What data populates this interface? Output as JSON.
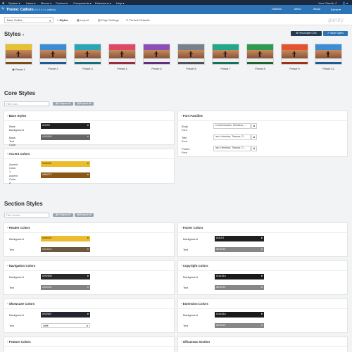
{
  "system_bar": {
    "logo": "✖",
    "menus": [
      "System ▾",
      "Users ▾",
      "Menus ▾",
      "Content ▾",
      "Components ▾",
      "Extensions ▾",
      "Help ▾"
    ],
    "right": [
      "Your Church ↗",
      "👤 ▾"
    ]
  },
  "header": {
    "title": "Theme: Callisto",
    "version": "(v1.0.4 / c_callisto)",
    "links": [
      "Outlines",
      "Menu",
      "About",
      "Extras ▾"
    ]
  },
  "toolbar": {
    "outline_value": "Base Outline",
    "tabs": [
      "Styles",
      "Layout",
      "Page Settings",
      "Particle Defaults"
    ],
    "brand": "gantry"
  },
  "styles": {
    "title": "Styles",
    "recompile_label": "Recompile CSS",
    "save_label": "Save Styles",
    "presets": [
      {
        "label": "Preset 1",
        "band": "#e8c12f",
        "accent": "#7a4b12",
        "selected": true
      },
      {
        "label": "Preset 2",
        "band": "#3b8ed6",
        "accent": "#1e5b94",
        "selected": false
      },
      {
        "label": "Preset 3",
        "band": "#2aa6b7",
        "accent": "#1b6a78",
        "selected": false
      },
      {
        "label": "Preset 4",
        "band": "#e14868",
        "accent": "#952d45",
        "selected": false
      },
      {
        "label": "Preset 5",
        "band": "#8d4fb6",
        "accent": "#5d2f7e",
        "selected": false
      },
      {
        "label": "Preset 6",
        "band": "#77818b",
        "accent": "#4a535c",
        "selected": false
      },
      {
        "label": "Preset 7",
        "band": "#21a889",
        "accent": "#13705a",
        "selected": false
      },
      {
        "label": "Preset 8",
        "band": "#2d9b4d",
        "accent": "#1c6532",
        "selected": false
      },
      {
        "label": "Preset 9",
        "band": "#e5522f",
        "accent": "#9b3218",
        "selected": false
      },
      {
        "label": "Preset 12",
        "band": "#3b8ed6",
        "accent": "#1e5b94",
        "selected": false
      }
    ]
  },
  "core_styles": {
    "title": "Core Styles",
    "filter_placeholder": "Filter Core...",
    "collapse_label": "Collapse All",
    "expand_label": "Expand All",
    "base": {
      "title": "Base Styles",
      "rows": [
        {
          "label": "Base Background",
          "value": "#1f1f1f",
          "color": "#1f1f1f",
          "text": "#ffffff"
        },
        {
          "label": "Base Text Color",
          "value": "#666666",
          "color": "#666666",
          "text": "#dddddd"
        }
      ]
    },
    "accent": {
      "title": "Accent Colors",
      "rows": [
        {
          "label": "Accent Color 1",
          "value": "#edbc2e",
          "color": "#edbc2e",
          "text": "#3a2c00"
        },
        {
          "label": "Accent Color 2",
          "value": "#8b5717",
          "color": "#8b5717",
          "text": "#ffffff"
        }
      ]
    },
    "fonts": {
      "title": "Font Families",
      "rows": [
        {
          "label": "Body Font",
          "value": "ecoreceansans, Helvetica, ..."
        },
        {
          "label": "Title Font",
          "value": "lato, Helvetica, Tahoma, G..."
        },
        {
          "label": "Promo Font",
          "value": "lato, Helvetica, Tahoma, G..."
        }
      ],
      "font_button": "A"
    }
  },
  "section_styles": {
    "title": "Section Styles",
    "filter_placeholder": "Filter Section...",
    "collapse_label": "Collapse All",
    "expand_label": "Expand All",
    "left": [
      {
        "title": "Header Colors",
        "rows": [
          {
            "label": "Background",
            "value": "#edbc2e",
            "color": "#edbc2e",
            "text": "#3a2c00"
          },
          {
            "label": "Text",
            "value": "#3e3022",
            "color": "#6a5840",
            "text": "#e6d8c0"
          }
        ]
      },
      {
        "title": "Navigation Colors",
        "rows": [
          {
            "label": "Background",
            "value": "#292826",
            "color": "#292826",
            "text": "#ffffff"
          },
          {
            "label": "Text",
            "value": "#828282",
            "color": "#828282",
            "text": "#e0e0e0"
          }
        ]
      },
      {
        "title": "Showcase Colors",
        "rows": [
          {
            "label": "Background",
            "value": "#23262f",
            "color": "#23262f",
            "text": "#ffffff"
          },
          {
            "label": "Text",
            "value": "#ffffff",
            "color": "#ffffff",
            "text": "#333333"
          }
        ]
      },
      {
        "title": "Feature Colors",
        "rows": []
      }
    ],
    "right": [
      {
        "title": "Footer Colors",
        "rows": [
          {
            "label": "Background",
            "value": "#1f1f1f",
            "color": "#1f1f1f",
            "text": "#ffffff"
          },
          {
            "label": "Text",
            "value": "#878787",
            "color": "#878787",
            "text": "#f0f0f0"
          }
        ]
      },
      {
        "title": "Copyright Colors",
        "rows": [
          {
            "label": "Background",
            "value": "#1a1a1a",
            "color": "#1a1a1a",
            "text": "#ffffff"
          },
          {
            "label": "Text",
            "value": "#878787",
            "color": "#878787",
            "text": "#f0f0f0"
          }
        ]
      },
      {
        "title": "Extension Colors",
        "rows": [
          {
            "label": "Background",
            "value": "#1a1a1a",
            "color": "#1a1a1a",
            "text": "#ffffff"
          },
          {
            "label": "Text",
            "value": "#878787",
            "color": "#878787",
            "text": "#f0f0f0"
          }
        ]
      },
      {
        "title": "Offcanvas Section",
        "rows": []
      }
    ]
  }
}
